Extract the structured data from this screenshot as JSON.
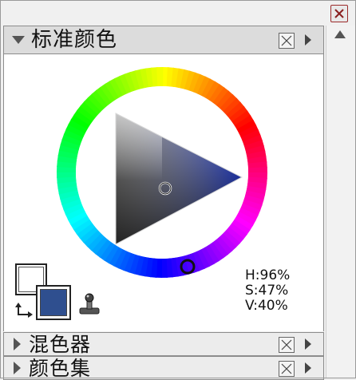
{
  "window": {
    "close_icon": "close-x-icon"
  },
  "panel": {
    "title": "标准颜色",
    "collapse_icon": "triangle-down-icon",
    "close_icon": "box-x-icon",
    "menu_icon": "triangle-right-icon"
  },
  "color": {
    "foreground": "#2f4f8f",
    "background": "#ffffff",
    "h_label": "H:96%",
    "s_label": "S:47%",
    "v_label": "V:40%"
  },
  "tools": {
    "swap_icon": "swap-arrows-icon",
    "eyedropper_icon": "eyedropper-icon"
  },
  "sections": [
    {
      "title": "混色器"
    },
    {
      "title": "颜色集"
    }
  ]
}
